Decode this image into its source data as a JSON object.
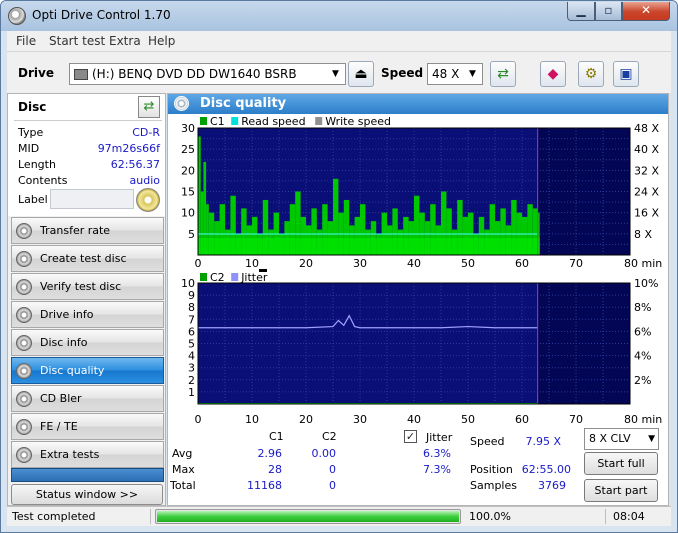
{
  "window": {
    "title": "Opti Drive Control 1.70",
    "min": "▁",
    "max": "▫",
    "close": "✕"
  },
  "menu": [
    "File",
    "Start test",
    "Extra",
    "Help"
  ],
  "toolbar": {
    "drive_label": "Drive",
    "drive_value": "(H:)  BENQ DVD DD DW1640 BSRB",
    "speed_label": "Speed",
    "speed_value": "48 X"
  },
  "disc": {
    "title": "Disc",
    "type_label": "Type",
    "type_value": "CD-R",
    "mid_label": "MID",
    "mid_value": "97m26s66f",
    "length_label": "Length",
    "length_value": "62:56.37",
    "contents_label": "Contents",
    "contents_value": "audio",
    "label_label": "Label",
    "label_value": ""
  },
  "nav": [
    {
      "label": "Transfer rate",
      "active": false
    },
    {
      "label": "Create test disc",
      "active": false
    },
    {
      "label": "Verify test disc",
      "active": false
    },
    {
      "label": "Drive info",
      "active": false
    },
    {
      "label": "Disc info",
      "active": false
    },
    {
      "label": "Disc quality",
      "active": true
    },
    {
      "label": "CD Bler",
      "active": false
    },
    {
      "label": "FE / TE",
      "active": false
    },
    {
      "label": "Extra tests",
      "active": false
    }
  ],
  "status_window_label": "Status window >>",
  "panel": {
    "title": "Disc quality"
  },
  "chart_data": [
    {
      "type": "area",
      "legend": [
        {
          "name": "C1",
          "color": "#00a000"
        },
        {
          "name": "Read speed",
          "color": "#00e0e0"
        },
        {
          "name": "Write speed",
          "color": "#909090"
        }
      ],
      "x_ticks": [
        0,
        10,
        20,
        30,
        40,
        50,
        60,
        70,
        80
      ],
      "x_unit": "min",
      "xlim": [
        0,
        80
      ],
      "ylim": [
        0,
        30
      ],
      "y_ticks": [
        5,
        10,
        15,
        20,
        25,
        30
      ],
      "y2_ticks": [
        "8 X",
        "16 X",
        "24 X",
        "32 X",
        "40 X",
        "48 X"
      ],
      "y2lim": [
        0,
        48
      ],
      "data_end_min": 62.9,
      "series": [
        {
          "name": "C1",
          "x": [
            0,
            0.5,
            1,
            1.5,
            2,
            3,
            4,
            5,
            6,
            7,
            8,
            9,
            10,
            11,
            12,
            13,
            14,
            15,
            16,
            17,
            18,
            19,
            20,
            21,
            22,
            23,
            24,
            25,
            26,
            27,
            28,
            29,
            30,
            31,
            32,
            33,
            34,
            35,
            36,
            37,
            38,
            39,
            40,
            41,
            42,
            43,
            44,
            45,
            46,
            47,
            48,
            49,
            50,
            51,
            52,
            53,
            54,
            55,
            56,
            57,
            58,
            59,
            60,
            61,
            62,
            62.9
          ],
          "values": [
            28,
            15,
            22,
            12,
            10,
            8,
            12,
            6,
            14,
            5,
            11,
            7,
            9,
            5,
            13,
            6,
            10,
            5,
            8,
            12,
            15,
            9,
            7,
            11,
            6,
            12,
            8,
            18,
            10,
            13,
            7,
            9,
            12,
            6,
            8,
            5,
            10,
            7,
            11,
            6,
            9,
            8,
            14,
            10,
            8,
            12,
            7,
            15,
            11,
            6,
            13,
            9,
            10,
            5,
            9,
            6,
            12,
            8,
            11,
            7,
            13,
            10,
            9,
            12,
            11,
            10
          ]
        },
        {
          "name": "Read speed",
          "x": [
            0,
            62.9
          ],
          "values": [
            7.95,
            7.95
          ]
        }
      ]
    },
    {
      "type": "line",
      "legend": [
        {
          "name": "C2",
          "color": "#00a000"
        },
        {
          "name": "Jitter",
          "color": "#9090ff"
        }
      ],
      "x_ticks": [
        0,
        10,
        20,
        30,
        40,
        50,
        60,
        70,
        80
      ],
      "x_unit": "min",
      "xlim": [
        0,
        80
      ],
      "ylim": [
        0,
        10
      ],
      "y_ticks": [
        1,
        2,
        3,
        4,
        5,
        6,
        7,
        8,
        9,
        10
      ],
      "y2_ticks": [
        "2%",
        "4%",
        "6%",
        "8%",
        "10%"
      ],
      "y2lim": [
        0,
        10
      ],
      "data_end_min": 62.9,
      "series": [
        {
          "name": "C2",
          "x": [
            0,
            62.9
          ],
          "values": [
            0,
            0
          ]
        },
        {
          "name": "Jitter",
          "x": [
            0,
            5,
            10,
            15,
            20,
            25,
            26,
            27,
            28,
            29,
            30,
            35,
            40,
            45,
            50,
            55,
            60,
            62.9
          ],
          "values": [
            6.3,
            6.3,
            6.3,
            6.3,
            6.3,
            6.4,
            6.9,
            6.5,
            7.3,
            6.4,
            6.3,
            6.3,
            6.3,
            6.3,
            6.4,
            6.3,
            6.3,
            6.3
          ]
        }
      ]
    }
  ],
  "stats": {
    "col_c1": "C1",
    "col_c2": "C2",
    "avg_label": "Avg",
    "avg_c1": "2.96",
    "avg_c2": "0.00",
    "avg_jitter": "6.3%",
    "max_label": "Max",
    "max_c1": "28",
    "max_c2": "0",
    "max_jitter": "7.3%",
    "total_label": "Total",
    "total_c1": "11168",
    "total_c2": "0",
    "jitter_label": "Jitter",
    "jitter_checked": "✓"
  },
  "info": {
    "speed_label": "Speed",
    "speed_value": "7.95 X",
    "position_label": "Position",
    "position_value": "62:55.00",
    "samples_label": "Samples",
    "samples_value": "3769",
    "mode_value": "8 X CLV",
    "start_full": "Start full",
    "start_part": "Start part"
  },
  "statusbar": {
    "text": "Test completed",
    "progress": 100,
    "percent": "100.0%",
    "time": "08:04"
  }
}
